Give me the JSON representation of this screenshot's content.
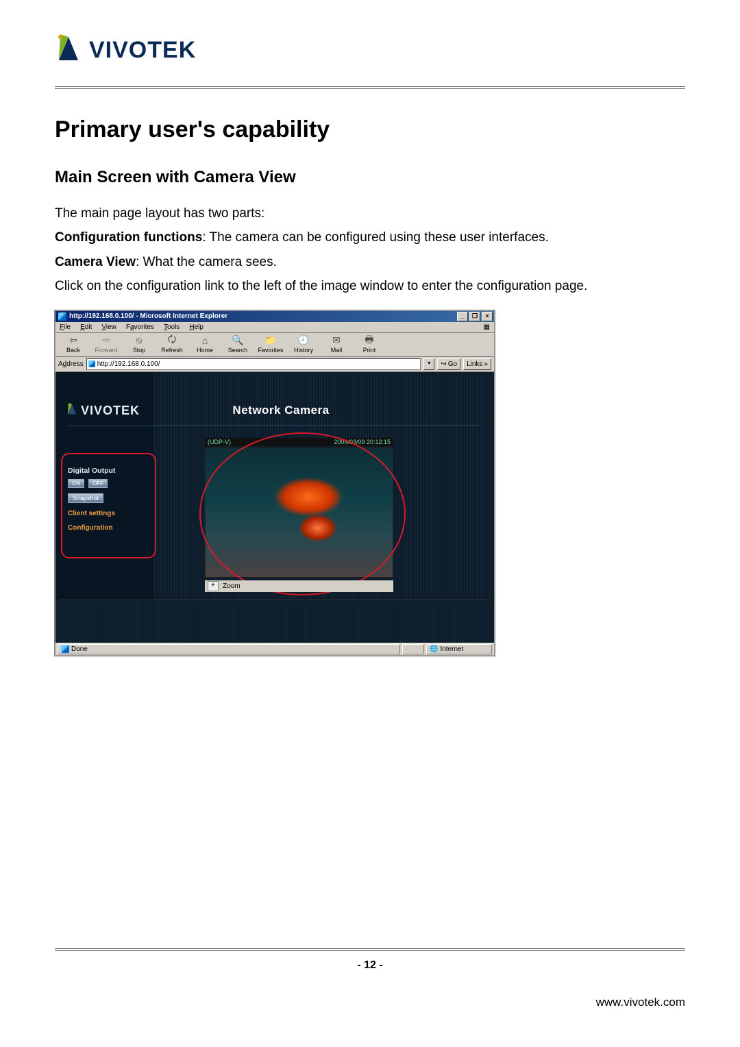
{
  "brand": {
    "name": "VIVOTEK"
  },
  "document": {
    "heading": "Primary user's capability",
    "subheading": "Main Screen with Camera View",
    "para_intro": "The main page layout has two parts:",
    "cfg_label": "Configuration functions",
    "cfg_text": ": The camera can be configured using these user interfaces.",
    "cam_label": "Camera View",
    "cam_text": ": What the camera sees.",
    "para_link": "Click on the configuration link to the left of the image window to enter the configuration page.",
    "page_number": "- 12 -",
    "footer_url": "www.vivotek.com"
  },
  "screenshot": {
    "title": "http://192.168.0.100/ - Microsoft Internet Explorer",
    "menus": {
      "file": "File",
      "edit": "Edit",
      "view": "View",
      "favorites": "Favorites",
      "tools": "Tools",
      "help": "Help"
    },
    "toolbar": {
      "back": "Back",
      "forward": "Forward",
      "stop": "Stop",
      "refresh": "Refresh",
      "home": "Home",
      "search": "Search",
      "favorites": "Favorites",
      "history": "History",
      "mail": "Mail",
      "print": "Print"
    },
    "address_label": "Address",
    "address_value": "http://192.168.0.100/",
    "go_label": "Go",
    "links_label": "Links",
    "camera": {
      "logo": "VIVOTEK",
      "title": "Network Camera",
      "proto": "(UDP-V)",
      "timestamp": "2004/03/09 20:12:15",
      "sidebar": {
        "digital_output": "Digital Output",
        "on": "ON",
        "off": "OFF",
        "snapshot": "Snapshot",
        "client_settings": "Client settings",
        "configuration": "Configuration"
      },
      "zoom_label": "Zoom"
    },
    "status_done": "Done",
    "status_zone": "Internet"
  }
}
